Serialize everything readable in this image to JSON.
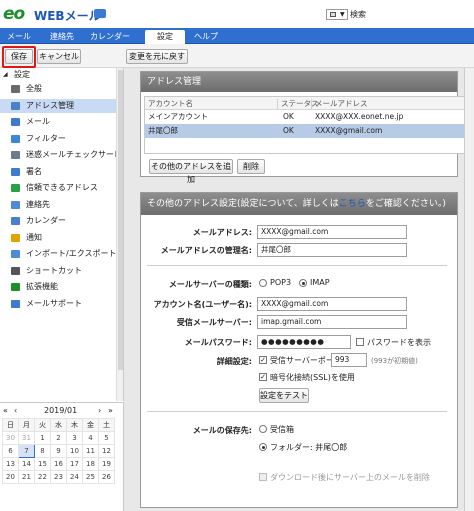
{
  "header": {
    "logo_mark": "eo",
    "logo_text": "WEBメール",
    "search_button": "検索"
  },
  "nav": {
    "tabs": [
      "メール",
      "連絡先",
      "カレンダー",
      "設定",
      "ヘルプ"
    ],
    "active": "設定"
  },
  "toolbar": {
    "save": "保存",
    "cancel": "キャンセル",
    "revert": "変更を元に戻す"
  },
  "sidebar": {
    "root_label": "設定",
    "items": [
      {
        "label": "全般",
        "icon": "gear-icon",
        "color": "#6a6a6a"
      },
      {
        "label": "アドレス管理",
        "icon": "address-book-icon",
        "color": "#4a7fc9"
      },
      {
        "label": "メール",
        "icon": "envelope-icon",
        "color": "#3f7ad0"
      },
      {
        "label": "フィルター",
        "icon": "filter-icon",
        "color": "#3a86d8"
      },
      {
        "label": "迷惑メールチェックサービス",
        "icon": "shield-check-icon",
        "color": "#6b7a8c"
      },
      {
        "label": "署名",
        "icon": "signature-icon",
        "color": "#3f7ad0"
      },
      {
        "label": "信頼できるアドレス",
        "icon": "trusted-shield-icon",
        "color": "#2aa142"
      },
      {
        "label": "連絡先",
        "icon": "contact-icon",
        "color": "#4e8ad6"
      },
      {
        "label": "カレンダー",
        "icon": "calendar-icon",
        "color": "#4a7fc9"
      },
      {
        "label": "通知",
        "icon": "bell-icon",
        "color": "#e0a400"
      },
      {
        "label": "インポート/エクスポート",
        "icon": "import-export-icon",
        "color": "#4e8ad6"
      },
      {
        "label": "ショートカット",
        "icon": "shortcut-icon",
        "color": "#555555"
      },
      {
        "label": "拡張機能",
        "icon": "extension-icon",
        "color": "#1a8f2a"
      },
      {
        "label": "メールサポート",
        "icon": "mail-support-icon",
        "color": "#3f7ad0"
      }
    ],
    "selected_index": 1
  },
  "calendar": {
    "title": "2019/01",
    "weekdays": [
      "日",
      "月",
      "火",
      "水",
      "木",
      "金",
      "土"
    ],
    "weeks": [
      [
        "30",
        "31",
        "1",
        "2",
        "3",
        "4",
        "5"
      ],
      [
        "6",
        "7",
        "8",
        "9",
        "10",
        "11",
        "12"
      ],
      [
        "13",
        "14",
        "15",
        "16",
        "17",
        "18",
        "19"
      ],
      [
        "20",
        "21",
        "22",
        "23",
        "24",
        "25",
        "26"
      ]
    ],
    "today": "7"
  },
  "address_panel": {
    "title": "アドレス管理",
    "columns": [
      "アカウント名",
      "ステータス",
      "メールアドレス"
    ],
    "rows": [
      {
        "account": "メインアカウント",
        "status": "OK",
        "email": "XXXX@XXX.eonet.ne.jp"
      },
      {
        "account": "井尾〇郎",
        "status": "OK",
        "email": "XXXX@gmail.com"
      }
    ],
    "add_button": "その他のアドレスを追加",
    "delete_button": "削除"
  },
  "other_panel": {
    "title_prefix": "その他のアドレス設定(設定について、詳しくは",
    "title_link": "こちら",
    "title_suffix": "をご確認ください。)",
    "email_label": "メールアドレス:",
    "email_value": "XXXX@gmail.com",
    "sender_name_label": "メールアドレスの管理名:",
    "sender_name_value": "井尾〇郎",
    "server_type_label": "メールサーバーの種類:",
    "pop3": "POP3",
    "imap": "IMAP",
    "account_label": "アカウント名(ユーザー名):",
    "account_value": "XXXX@gmail.com",
    "incoming_label": "受信メールサーバー:",
    "incoming_value": "imap.gmail.com",
    "password_label": "メールパスワード:",
    "password_value": "●●●●●●●●●",
    "show_password": "パスワードを表示",
    "advanced_label": "詳細設定:",
    "port_check": "受信サーバーポートを変更",
    "port_value": "993",
    "port_hint": "(993が初期値)",
    "ssl_check": "暗号化接続(SSL)を使用",
    "test_button": "設定をテスト",
    "save_to_label": "メールの保存先:",
    "inbox": "受信箱",
    "folder": "フォルダー: 井尾〇郎",
    "delete_after": "ダウンロード後にサーバー上のメールを削除"
  }
}
